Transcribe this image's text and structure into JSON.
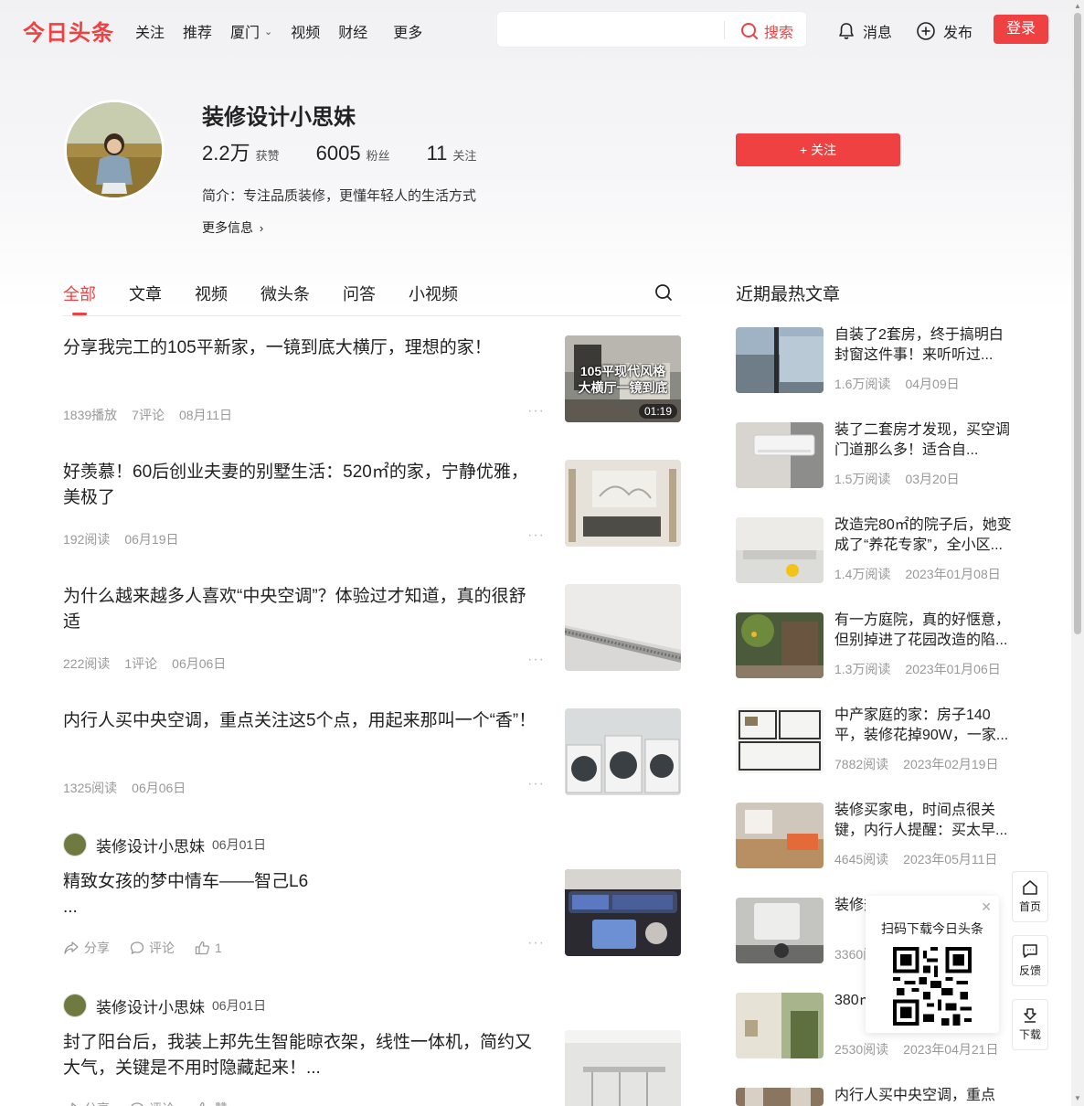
{
  "header": {
    "logo": "今日头条",
    "nav": [
      {
        "label": "关注"
      },
      {
        "label": "推荐"
      },
      {
        "label": "厦门"
      },
      {
        "label": "视频"
      },
      {
        "label": "财经"
      },
      {
        "label": "更多"
      }
    ],
    "search_value": "",
    "search_label": "搜索",
    "messages_label": "消息",
    "publish_label": "发布",
    "login_label": "登录"
  },
  "profile": {
    "name": "装修设计小思妹",
    "likes_num": "2.2万",
    "likes_label": "获赞",
    "fans_num": "6005",
    "fans_label": "粉丝",
    "following_num": "11",
    "following_label": "关注",
    "bio": "简介：专注品质装修，更懂年轻人的生活方式",
    "more_info": "更多信息",
    "follow_label": "+ 关注"
  },
  "tabs": [
    {
      "label": "全部"
    },
    {
      "label": "文章"
    },
    {
      "label": "视频"
    },
    {
      "label": "微头条"
    },
    {
      "label": "问答"
    },
    {
      "label": "小视频"
    }
  ],
  "feed": [
    {
      "title": "分享我完工的105平新家，一镜到底大横厅，理想的家！",
      "meta": [
        "1839播放",
        "7评论",
        "08月11日"
      ],
      "thumb_overlay": "105平现代风格\n大横厅一镜到底",
      "duration": "01:19"
    },
    {
      "title": "好羡慕！60后创业夫妻的别墅生活：520㎡的家，宁静优雅，美极了",
      "meta": [
        "192阅读",
        "06月19日"
      ]
    },
    {
      "title": "为什么越来越多人喜欢“中央空调”？体验过才知道，真的很舒适",
      "meta": [
        "222阅读",
        "1评论",
        "06月06日"
      ]
    },
    {
      "title": "内行人买中央空调，重点关注这5个点，用起来那叫一个“香”！",
      "meta": [
        "1325阅读",
        "06月06日"
      ]
    }
  ],
  "posts": [
    {
      "author": "装修设计小思妹",
      "date": "06月01日",
      "text": "精致女孩的梦中情车——智己L6",
      "ellipsis": "...",
      "share": "分享",
      "comment": "评论",
      "likes": "1"
    },
    {
      "author": "装修设计小思妹",
      "date": "06月01日",
      "text": "封了阳台后，我装上邦先生智能晾衣架，线性一体机，简约又大气，关键是不用时隐藏起来！...",
      "share": "分享",
      "comment": "评论",
      "likes": "赞"
    }
  ],
  "hot": {
    "title": "近期最热文章",
    "items": [
      {
        "text": "自装了2套房，终于搞明白封窗这件事！来听听过...",
        "reads": "1.6万阅读",
        "date": "04月09日"
      },
      {
        "text": "装了二套房才发现，买空调门道那么多！适合自...",
        "reads": "1.5万阅读",
        "date": "03月20日"
      },
      {
        "text": "改造完80㎡的院子后，她变成了“养花专家”，全小区...",
        "reads": "1.4万阅读",
        "date": "2023年01月08日"
      },
      {
        "text": "有一方庭院，真的好惬意，但别掉进了花园改造的陷...",
        "reads": "1.3万阅读",
        "date": "2023年01月06日"
      },
      {
        "text": "中产家庭的家：房子140平，装修花掉90W，一家...",
        "reads": "7882阅读",
        "date": "2023年02月19日"
      },
      {
        "text": "装修买家电，时间点很关键，内行人提醒：买太早...",
        "reads": "4645阅读",
        "date": "2023年05月11日"
      },
      {
        "text": "装修热水器到底...",
        "reads": "3360阅读",
        "date": ""
      },
      {
        "text": "380㎡+地上...",
        "reads": "2530阅读",
        "date": "2023年04月21日"
      },
      {
        "text": "内行人买中央空调，重点",
        "reads": "",
        "date": ""
      }
    ]
  },
  "qr": {
    "title": "扫码下载今日头条"
  },
  "side": {
    "home": "首页",
    "feedback": "反馈",
    "download": "下载"
  }
}
